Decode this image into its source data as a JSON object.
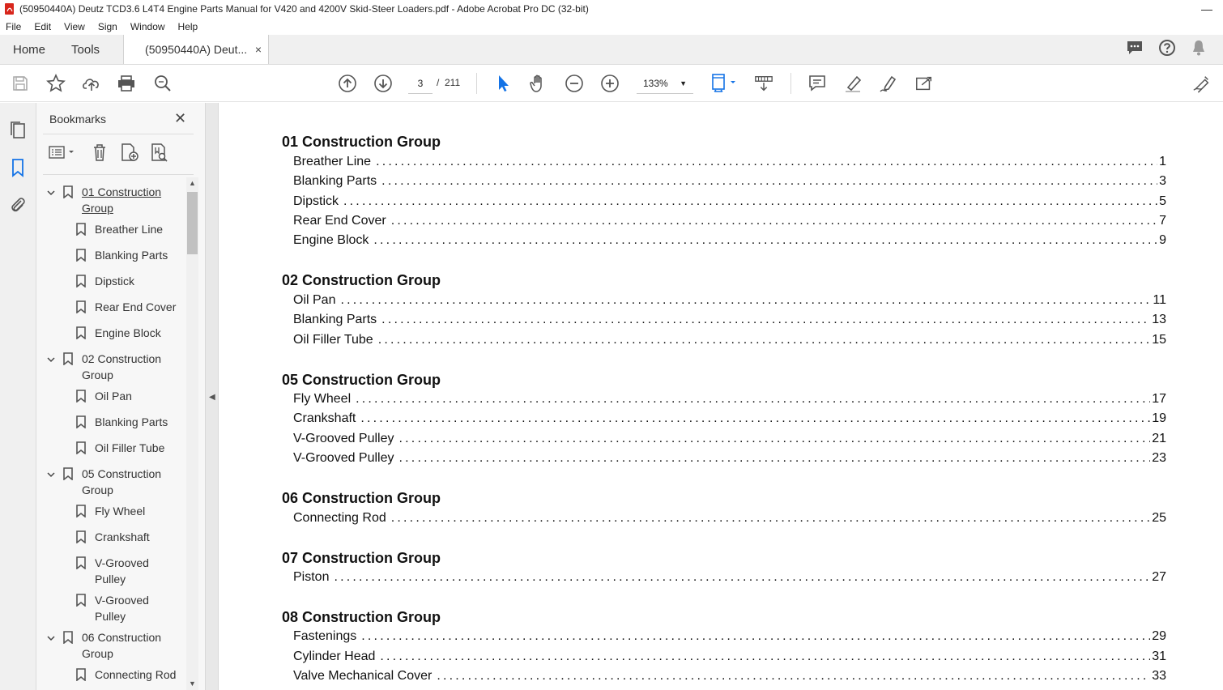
{
  "window": {
    "title": "(50950440A) Deutz TCD3.6 L4T4 Engine Parts Manual for V420 and 4200V Skid-Steer Loaders.pdf - Adobe Acrobat Pro DC (32-bit)",
    "minimize": "—"
  },
  "menu": [
    "File",
    "Edit",
    "View",
    "Sign",
    "Window",
    "Help"
  ],
  "tabs": {
    "home": "Home",
    "tools": "Tools",
    "doc": "(50950440A) Deut...",
    "close": "×"
  },
  "toolbar": {
    "page_current": "3",
    "page_sep": "/",
    "page_total": "211",
    "zoom": "133%"
  },
  "bookmarks": {
    "title": "Bookmarks",
    "close": "✕",
    "items": [
      {
        "label": "01 Construction Group",
        "level": 0,
        "expanded": true
      },
      {
        "label": "Breather Line",
        "level": 1
      },
      {
        "label": "Blanking Parts",
        "level": 1
      },
      {
        "label": "Dipstick",
        "level": 1
      },
      {
        "label": "Rear End Cover",
        "level": 1
      },
      {
        "label": "Engine Block",
        "level": 1
      },
      {
        "label": "02 Construction Group",
        "level": 0,
        "expanded": true
      },
      {
        "label": "Oil Pan",
        "level": 1
      },
      {
        "label": "Blanking Parts",
        "level": 1
      },
      {
        "label": "Oil Filler Tube",
        "level": 1
      },
      {
        "label": "05 Construction Group",
        "level": 0,
        "expanded": true
      },
      {
        "label": "Fly Wheel",
        "level": 1
      },
      {
        "label": "Crankshaft",
        "level": 1
      },
      {
        "label": "V-Grooved Pulley",
        "level": 1
      },
      {
        "label": "V-Grooved Pulley",
        "level": 1
      },
      {
        "label": "06 Construction Group",
        "level": 0,
        "expanded": true
      },
      {
        "label": "Connecting Rod",
        "level": 1
      }
    ]
  },
  "toc": [
    {
      "group": "01 Construction Group",
      "entries": [
        {
          "name": "Breather Line",
          "page": "1"
        },
        {
          "name": "Blanking Parts",
          "page": "3"
        },
        {
          "name": "Dipstick",
          "page": "5"
        },
        {
          "name": "Rear End Cover",
          "page": "7"
        },
        {
          "name": "Engine Block",
          "page": "9"
        }
      ]
    },
    {
      "group": "02 Construction Group",
      "entries": [
        {
          "name": "Oil Pan",
          "page": "11"
        },
        {
          "name": "Blanking Parts",
          "page": "13"
        },
        {
          "name": "Oil Filler Tube",
          "page": "15"
        }
      ]
    },
    {
      "group": "05 Construction Group",
      "entries": [
        {
          "name": "Fly Wheel",
          "page": "17"
        },
        {
          "name": "Crankshaft",
          "page": "19"
        },
        {
          "name": "V-Grooved Pulley",
          "page": "21"
        },
        {
          "name": "V-Grooved Pulley",
          "page": "23"
        }
      ]
    },
    {
      "group": "06 Construction Group",
      "entries": [
        {
          "name": "Connecting Rod",
          "page": "25"
        }
      ]
    },
    {
      "group": "07 Construction Group",
      "entries": [
        {
          "name": "Piston",
          "page": "27"
        }
      ]
    },
    {
      "group": "08 Construction Group",
      "entries": [
        {
          "name": "Fastenings",
          "page": "29"
        },
        {
          "name": "Cylinder Head",
          "page": "31"
        },
        {
          "name": "Valve Mechanical Cover",
          "page": "33"
        }
      ]
    }
  ],
  "colors": {
    "accent_blue": "#1473e6",
    "icon_gray": "#555555"
  }
}
